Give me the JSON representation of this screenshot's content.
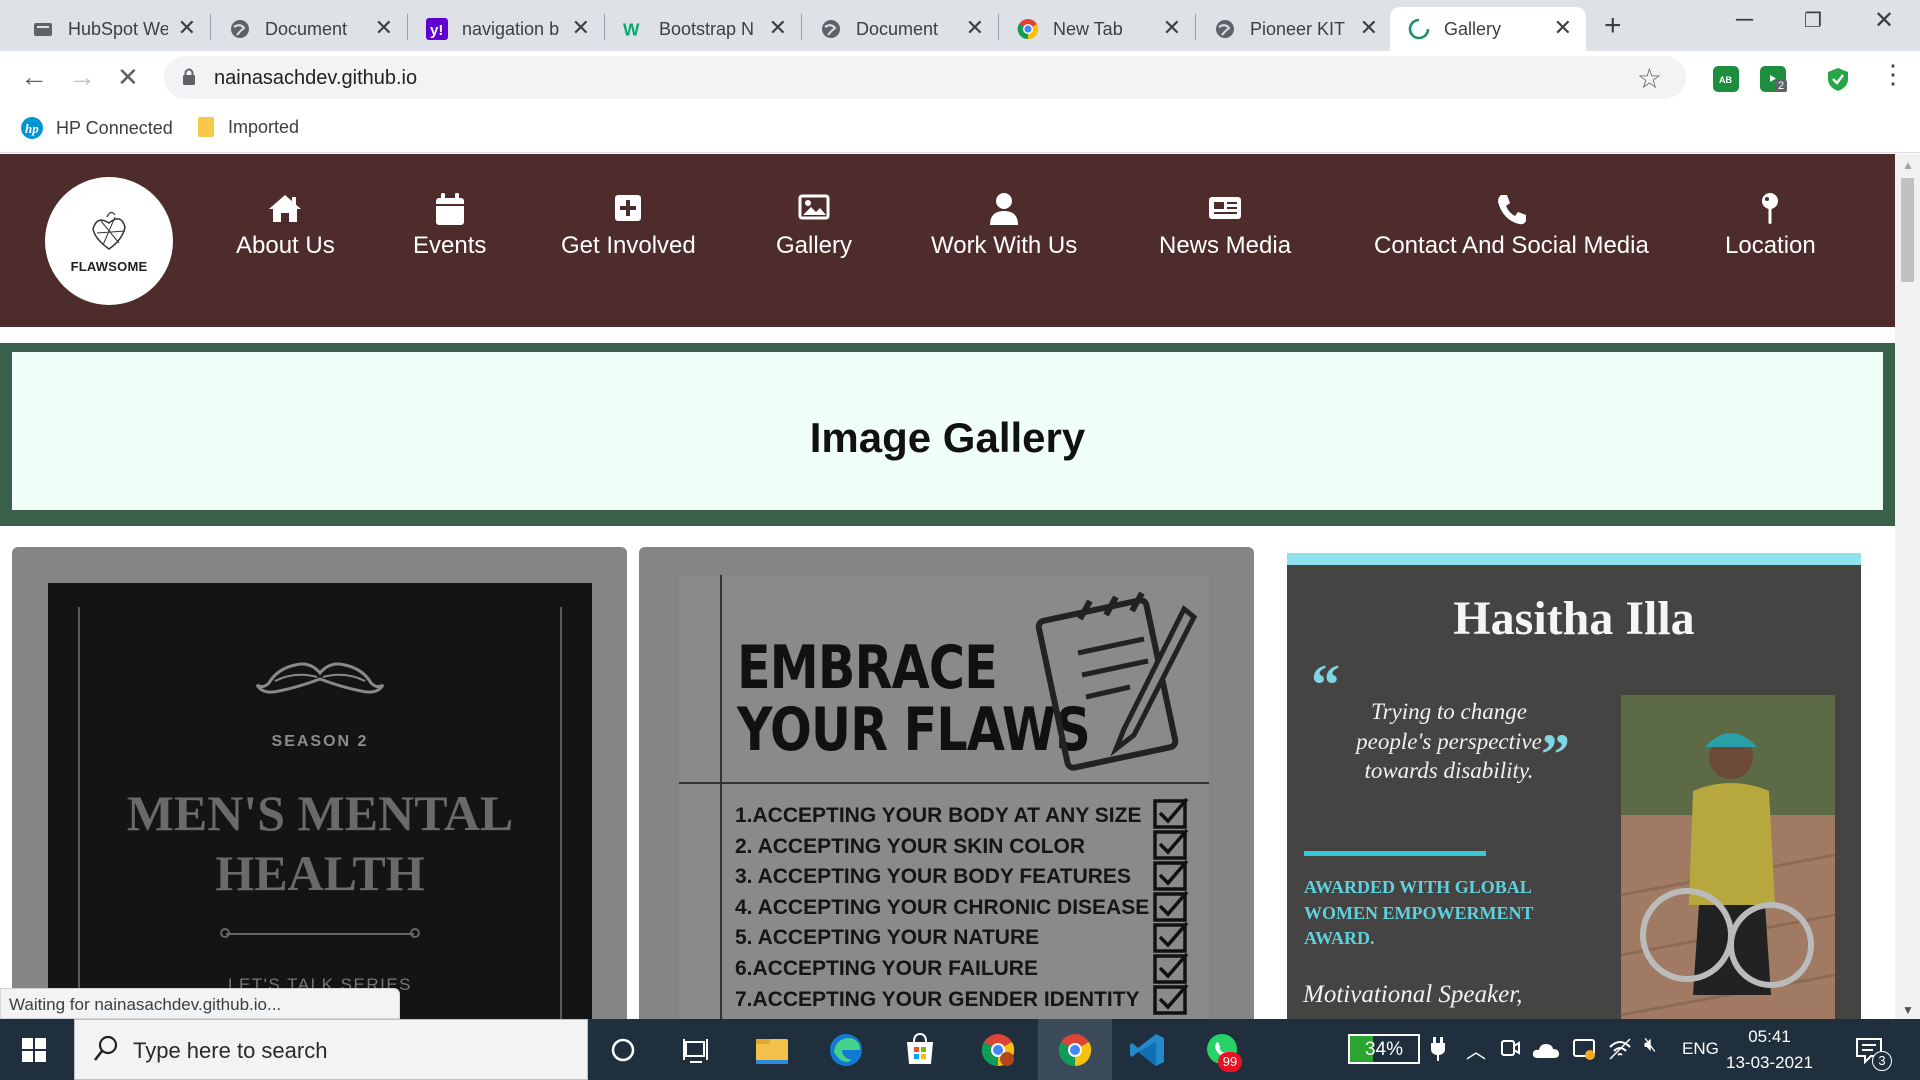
{
  "browser": {
    "tabs": [
      {
        "title": "HubSpot We",
        "icon": "hubspot-icon"
      },
      {
        "title": "Document",
        "icon": "globe-icon"
      },
      {
        "title": "navigation b",
        "icon": "yahoo-icon"
      },
      {
        "title": "Bootstrap N",
        "icon": "w3schools-icon"
      },
      {
        "title": "Document",
        "icon": "globe-icon"
      },
      {
        "title": "New Tab",
        "icon": "chrome-icon"
      },
      {
        "title": "Pioneer KITC",
        "icon": "globe-icon"
      },
      {
        "title": "Gallery",
        "icon": "loading-icon",
        "active": true
      }
    ],
    "url": "nainasachdev.github.io",
    "bookmarks": [
      {
        "label": "HP Connected",
        "icon": "hp-icon"
      },
      {
        "label": "Imported",
        "icon": "folder-icon"
      }
    ],
    "extension_badge": "2",
    "status_text": "Waiting for nainasachdev.github.io..."
  },
  "site": {
    "logo_text": "FLAWSOME",
    "nav": [
      {
        "label": "About Us",
        "icon": "home-icon"
      },
      {
        "label": "Events",
        "icon": "calendar-icon"
      },
      {
        "label": "Get Involved",
        "icon": "plus-square-icon"
      },
      {
        "label": "Gallery",
        "icon": "image-icon"
      },
      {
        "label": "Work With Us",
        "icon": "user-icon"
      },
      {
        "label": "News Media",
        "icon": "newspaper-icon"
      },
      {
        "label": "Contact And Social Media",
        "icon": "phone-icon"
      },
      {
        "label": "Location",
        "icon": "map-pin-icon"
      }
    ],
    "heading": "Image Gallery",
    "colors": {
      "nav_bg": "#4f2c2c",
      "banner_border": "#3a5f4b",
      "banner_bg": "#f0fff8"
    }
  },
  "gallery": {
    "poster1": {
      "season": "SEASON 2",
      "title_line1": "MEN'S MENTAL",
      "title_line2": "HEALTH",
      "subtitle": "LET'S TALK SERIES"
    },
    "poster2": {
      "title_line1": "EMBRACE",
      "title_line2": "YOUR FLAWS",
      "items": [
        "1.ACCEPTING  YOUR BODY AT ANY SIZE",
        "2. ACCEPTING YOUR SKIN COLOR",
        "3. ACCEPTING YOUR BODY FEATURES",
        "4. ACCEPTING YOUR CHRONIC DISEASE",
        "5. ACCEPTING YOUR NATURE",
        "6.ACCEPTING YOUR FAILURE",
        "7.ACCEPTING YOUR GENDER IDENTITY"
      ]
    },
    "poster3": {
      "name": "Hasitha  Illa",
      "quote": "Trying to change people's perspective towards disability.",
      "award": "AWARDED WITH  GLOBAL WOMEN EMPOWERMENT AWARD.",
      "role": "Motivational Speaker,"
    }
  },
  "taskbar": {
    "search_placeholder": "Type here to search",
    "battery": "34%",
    "battery_level": 0.34,
    "language": "ENG",
    "time": "05:41",
    "date": "13-03-2021",
    "whatsapp_badge": "99",
    "notification_count": "3"
  }
}
